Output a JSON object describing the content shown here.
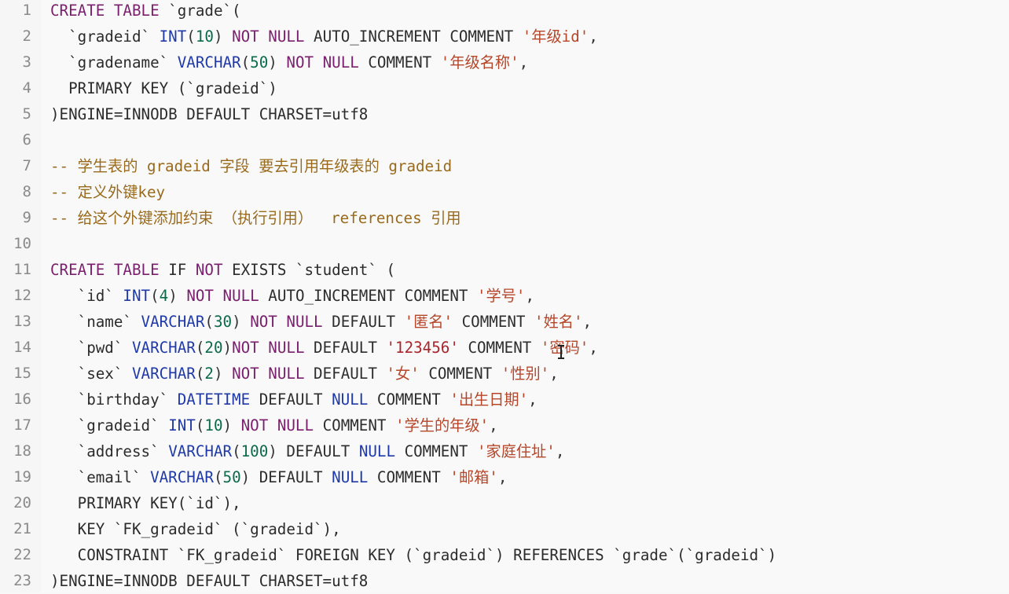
{
  "lines": [
    {
      "num": "1",
      "tokens": [
        [
          "CREATE",
          "kw2"
        ],
        [
          " ",
          "id"
        ],
        [
          "TABLE",
          "kw2"
        ],
        [
          " `grade`(",
          "id"
        ]
      ]
    },
    {
      "num": "2",
      "tokens": [
        [
          "  `gradeid` ",
          "id"
        ],
        [
          "INT",
          "type"
        ],
        [
          "(",
          "punc"
        ],
        [
          "10",
          "num"
        ],
        [
          ") ",
          "punc"
        ],
        [
          "NOT NULL",
          "kw2"
        ],
        [
          " AUTO_INCREMENT COMMENT ",
          "kw"
        ],
        [
          "'年级id'",
          "str"
        ],
        [
          ",",
          "punc"
        ]
      ]
    },
    {
      "num": "3",
      "tokens": [
        [
          "  `gradename` ",
          "id"
        ],
        [
          "VARCHAR",
          "type"
        ],
        [
          "(",
          "punc"
        ],
        [
          "50",
          "num"
        ],
        [
          ") ",
          "punc"
        ],
        [
          "NOT NULL",
          "kw2"
        ],
        [
          " COMMENT ",
          "kw"
        ],
        [
          "'年级名称'",
          "str"
        ],
        [
          ",",
          "punc"
        ]
      ]
    },
    {
      "num": "4",
      "tokens": [
        [
          "  PRIMARY KEY (`gradeid`)",
          "id"
        ]
      ]
    },
    {
      "num": "5",
      "tokens": [
        [
          ")ENGINE=INNODB DEFAULT CHARSET=utf8",
          "id"
        ]
      ]
    },
    {
      "num": "6",
      "tokens": []
    },
    {
      "num": "7",
      "tokens": [
        [
          "-- 学生表的 gradeid 字段 要去引用年级表的 gradeid",
          "comment"
        ]
      ]
    },
    {
      "num": "8",
      "tokens": [
        [
          "-- 定义外键key",
          "comment"
        ]
      ]
    },
    {
      "num": "9",
      "tokens": [
        [
          "-- 给这个外键添加约束 （执行引用）  references 引用",
          "comment"
        ]
      ]
    },
    {
      "num": "10",
      "tokens": []
    },
    {
      "num": "11",
      "tokens": [
        [
          "CREATE",
          "kw2"
        ],
        [
          " ",
          "id"
        ],
        [
          "TABLE",
          "kw2"
        ],
        [
          " IF ",
          "id"
        ],
        [
          "NOT",
          "kw2"
        ],
        [
          " EXISTS `student` (",
          "id"
        ]
      ]
    },
    {
      "num": "12",
      "tokens": [
        [
          "   `id` ",
          "id"
        ],
        [
          "INT",
          "type"
        ],
        [
          "(",
          "punc"
        ],
        [
          "4",
          "num"
        ],
        [
          ") ",
          "punc"
        ],
        [
          "NOT NULL",
          "kw2"
        ],
        [
          " AUTO_INCREMENT COMMENT ",
          "kw"
        ],
        [
          "'学号'",
          "str"
        ],
        [
          ",",
          "punc"
        ]
      ]
    },
    {
      "num": "13",
      "tokens": [
        [
          "   `name` ",
          "id"
        ],
        [
          "VARCHAR",
          "type"
        ],
        [
          "(",
          "punc"
        ],
        [
          "30",
          "num"
        ],
        [
          ") ",
          "punc"
        ],
        [
          "NOT NULL",
          "kw2"
        ],
        [
          " DEFAULT ",
          "kw"
        ],
        [
          "'匿名'",
          "str"
        ],
        [
          " COMMENT ",
          "kw"
        ],
        [
          "'姓名'",
          "str"
        ],
        [
          ",",
          "punc"
        ]
      ]
    },
    {
      "num": "14",
      "tokens": [
        [
          "   `pwd` ",
          "id"
        ],
        [
          "VARCHAR",
          "type"
        ],
        [
          "(",
          "punc"
        ],
        [
          "20",
          "num"
        ],
        [
          ")",
          "punc"
        ],
        [
          "NOT NULL",
          "kw2"
        ],
        [
          " DEFAULT ",
          "kw"
        ],
        [
          "'123456'",
          "strnum"
        ],
        [
          " COMMENT ",
          "kw"
        ],
        [
          "'密码'",
          "str"
        ],
        [
          ",",
          "punc"
        ]
      ]
    },
    {
      "num": "15",
      "tokens": [
        [
          "   `sex` ",
          "id"
        ],
        [
          "VARCHAR",
          "type"
        ],
        [
          "(",
          "punc"
        ],
        [
          "2",
          "num"
        ],
        [
          ") ",
          "punc"
        ],
        [
          "NOT NULL",
          "kw2"
        ],
        [
          " DEFAULT ",
          "kw"
        ],
        [
          "'女'",
          "str"
        ],
        [
          " COMMENT ",
          "kw"
        ],
        [
          "'性别'",
          "str"
        ],
        [
          ",",
          "punc"
        ]
      ]
    },
    {
      "num": "16",
      "tokens": [
        [
          "   `birthday` ",
          "id"
        ],
        [
          "DATETIME",
          "type"
        ],
        [
          " DEFAULT ",
          "kw"
        ],
        [
          "NULL",
          "type"
        ],
        [
          " COMMENT ",
          "kw"
        ],
        [
          "'出生日期'",
          "str"
        ],
        [
          ",",
          "punc"
        ]
      ]
    },
    {
      "num": "17",
      "tokens": [
        [
          "   `gradeid` ",
          "id"
        ],
        [
          "INT",
          "type"
        ],
        [
          "(",
          "punc"
        ],
        [
          "10",
          "num"
        ],
        [
          ") ",
          "punc"
        ],
        [
          "NOT NULL",
          "kw2"
        ],
        [
          " COMMENT ",
          "kw"
        ],
        [
          "'学生的年级'",
          "str"
        ],
        [
          ",",
          "punc"
        ]
      ]
    },
    {
      "num": "18",
      "tokens": [
        [
          "   `address` ",
          "id"
        ],
        [
          "VARCHAR",
          "type"
        ],
        [
          "(",
          "punc"
        ],
        [
          "100",
          "num"
        ],
        [
          ") ",
          "punc"
        ],
        [
          "DEFAULT ",
          "kw"
        ],
        [
          "NULL",
          "type"
        ],
        [
          " COMMENT ",
          "kw"
        ],
        [
          "'家庭住址'",
          "str"
        ],
        [
          ",",
          "punc"
        ]
      ]
    },
    {
      "num": "19",
      "tokens": [
        [
          "   `email` ",
          "id"
        ],
        [
          "VARCHAR",
          "type"
        ],
        [
          "(",
          "punc"
        ],
        [
          "50",
          "num"
        ],
        [
          ") ",
          "punc"
        ],
        [
          "DEFAULT ",
          "kw"
        ],
        [
          "NULL",
          "type"
        ],
        [
          " COMMENT ",
          "kw"
        ],
        [
          "'邮箱'",
          "str"
        ],
        [
          ",",
          "punc"
        ]
      ]
    },
    {
      "num": "20",
      "tokens": [
        [
          "   PRIMARY KEY(`id`),",
          "id"
        ]
      ]
    },
    {
      "num": "21",
      "tokens": [
        [
          "   KEY `FK_gradeid` (`gradeid`),",
          "id"
        ]
      ]
    },
    {
      "num": "22",
      "tokens": [
        [
          "   CONSTRAINT `FK_gradeid` FOREIGN KEY (`gradeid`) REFERENCES `grade`(`gradeid`)",
          "id"
        ]
      ]
    },
    {
      "num": "23",
      "tokens": [
        [
          ")ENGINE=INNODB DEFAULT CHARSET=utf8",
          "id"
        ]
      ]
    }
  ]
}
